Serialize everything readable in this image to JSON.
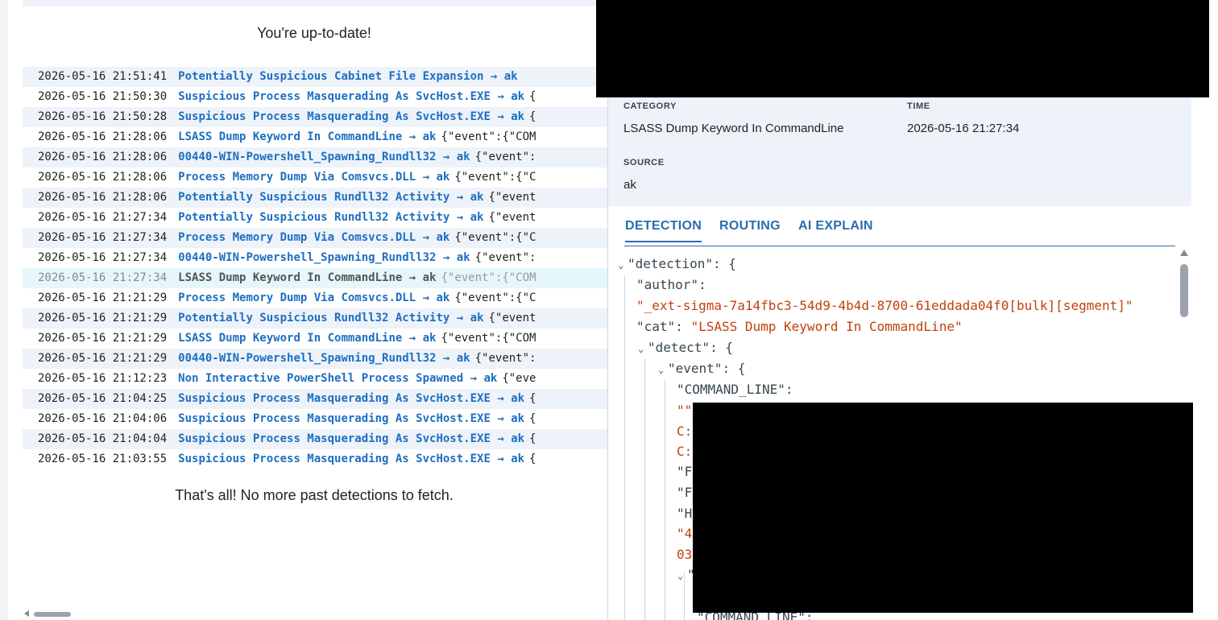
{
  "list": {
    "up_to_date": "You're up-to-date!",
    "end_message": "That's all! No more past detections to fetch.",
    "rows": [
      {
        "time": "2026-05-16 21:51:41",
        "name": "Potentially Suspicious Cabinet File Expansion",
        "sensor": "ak",
        "payload": ""
      },
      {
        "time": "2026-05-16 21:50:30",
        "name": "Suspicious Process Masquerading As SvcHost.EXE",
        "sensor": "ak",
        "payload": "{"
      },
      {
        "time": "2026-05-16 21:50:28",
        "name": "Suspicious Process Masquerading As SvcHost.EXE",
        "sensor": "ak",
        "payload": "{"
      },
      {
        "time": "2026-05-16 21:28:06",
        "name": "LSASS Dump Keyword In CommandLine",
        "sensor": "ak",
        "payload": "{\"event\":{\"COM"
      },
      {
        "time": "2026-05-16 21:28:06",
        "name": "00440-WIN-Powershell_Spawning_Rundll32",
        "sensor": "ak",
        "payload": "{\"event\":"
      },
      {
        "time": "2026-05-16 21:28:06",
        "name": "Process Memory Dump Via Comsvcs.DLL",
        "sensor": "ak",
        "payload": "{\"event\":{\"C"
      },
      {
        "time": "2026-05-16 21:28:06",
        "name": "Potentially Suspicious Rundll32 Activity",
        "sensor": "ak",
        "payload": "{\"event"
      },
      {
        "time": "2026-05-16 21:27:34",
        "name": "Potentially Suspicious Rundll32 Activity",
        "sensor": "ak",
        "payload": "{\"event"
      },
      {
        "time": "2026-05-16 21:27:34",
        "name": "Process Memory Dump Via Comsvcs.DLL",
        "sensor": "ak",
        "payload": "{\"event\":{\"C"
      },
      {
        "time": "2026-05-16 21:27:34",
        "name": "00440-WIN-Powershell_Spawning_Rundll32",
        "sensor": "ak",
        "payload": "{\"event\":"
      },
      {
        "time": "2026-05-16 21:27:34",
        "name": "LSASS Dump Keyword In CommandLine",
        "sensor": "ak",
        "payload": "{\"event\":{\"COM"
      },
      {
        "time": "2026-05-16 21:21:29",
        "name": "Process Memory Dump Via Comsvcs.DLL",
        "sensor": "ak",
        "payload": "{\"event\":{\"C"
      },
      {
        "time": "2026-05-16 21:21:29",
        "name": "Potentially Suspicious Rundll32 Activity",
        "sensor": "ak",
        "payload": "{\"event"
      },
      {
        "time": "2026-05-16 21:21:29",
        "name": "LSASS Dump Keyword In CommandLine",
        "sensor": "ak",
        "payload": "{\"event\":{\"COM"
      },
      {
        "time": "2026-05-16 21:21:29",
        "name": "00440-WIN-Powershell_Spawning_Rundll32",
        "sensor": "ak",
        "payload": "{\"event\":"
      },
      {
        "time": "2026-05-16 21:12:23",
        "name": "Non Interactive PowerShell Process Spawned",
        "sensor": "ak",
        "payload": "{\"eve"
      },
      {
        "time": "2026-05-16 21:04:25",
        "name": "Suspicious Process Masquerading As SvcHost.EXE",
        "sensor": "ak",
        "payload": "{"
      },
      {
        "time": "2026-05-16 21:04:06",
        "name": "Suspicious Process Masquerading As SvcHost.EXE",
        "sensor": "ak",
        "payload": "{"
      },
      {
        "time": "2026-05-16 21:04:04",
        "name": "Suspicious Process Masquerading As SvcHost.EXE",
        "sensor": "ak",
        "payload": "{"
      },
      {
        "time": "2026-05-16 21:03:55",
        "name": "Suspicious Process Masquerading As SvcHost.EXE",
        "sensor": "ak",
        "payload": "{"
      }
    ]
  },
  "detail": {
    "category_label": "CATEGORY",
    "category_value": "LSASS Dump Keyword In CommandLine",
    "time_label": "TIME",
    "time_value": "2026-05-16 21:27:34",
    "source_label": "SOURCE",
    "source_value": "ak",
    "tabs": [
      "DETECTION",
      "ROUTING",
      "AI EXPLAIN"
    ],
    "json": {
      "detection_key": "\"detection\"",
      "open_brace": "{",
      "author_key": "\"author\"",
      "author_value": "\"_ext-sigma-7a14fbc3-54d9-4b4d-8700-61eddada04f0[bulk][segment]\"",
      "cat_key": "\"cat\"",
      "cat_value": "\"LSASS Dump Keyword In CommandLine\"",
      "detect_key": "\"detect\"",
      "event_key": "\"event\"",
      "command_line_key": "\"COMMAND_LINE\"",
      "partial_1": "\"\"",
      "partial_2": "C:",
      "partial_3": "C:",
      "partial_4": "\"F",
      "partial_5": "\"F",
      "partial_6": "\"H",
      "partial_7": "\"4",
      "partial_8": "03",
      "partial_9": "\"",
      "command_line_key_2": "\"COMMAND_LINE\":"
    }
  },
  "colors": {
    "link_blue": "#1d6fc1",
    "json_string": "#c2410c",
    "row_shade": "#eef3fa",
    "row_selected": "#e6f7fb",
    "redaction": "#000000"
  }
}
